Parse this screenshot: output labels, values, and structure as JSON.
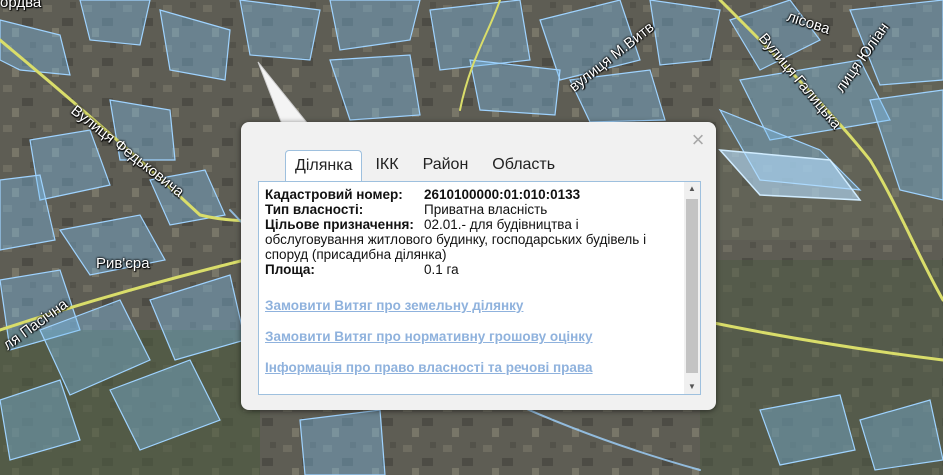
{
  "map": {
    "labels": [
      {
        "text": "Вулиця Федьковича",
        "name": "street-label-fedkovycha"
      },
      {
        "text": "Рив'єра",
        "name": "poi-label-riviera"
      },
      {
        "text": "ля Пасічна",
        "name": "street-label-pasichna"
      },
      {
        "text": "вулиця М.Витв",
        "name": "street-label-m-vytv"
      },
      {
        "text": "Вулиця Галицька",
        "name": "street-label-halytska"
      },
      {
        "text": "лісова",
        "name": "street-label-lisova"
      },
      {
        "text": "лиця Юліан",
        "name": "street-label-yulian"
      },
      {
        "text": "ордва",
        "name": "street-label-ordva"
      }
    ],
    "colors": {
      "parcel": "#8ec8f4",
      "road": "#d9dd6a",
      "highlight": "#b5e0ff"
    }
  },
  "popup": {
    "close_label": "×",
    "tabs": [
      {
        "label": "Ділянка",
        "active": true
      },
      {
        "label": "ІКК",
        "active": false
      },
      {
        "label": "Район",
        "active": false
      },
      {
        "label": "Область",
        "active": false
      }
    ],
    "fields": [
      {
        "key": "Кадастровий номер:",
        "value": "2610100000:01:010:0133"
      },
      {
        "key": "Тип власності:",
        "value": "Приватна власність"
      },
      {
        "key": "Цільове призначення:",
        "value": "02.01.- для будівництва і",
        "value_cont": "обслуговування житлового будинку, господарських будівель і споруд (присадибна ділянка)"
      },
      {
        "key": "Площа:",
        "value": "0.1 га"
      }
    ],
    "links": [
      "Замовити Витяг про земельну ділянку",
      "Замовити Витяг про нормативну грошову оцінку",
      "Інформація про право власності та речові права"
    ]
  }
}
